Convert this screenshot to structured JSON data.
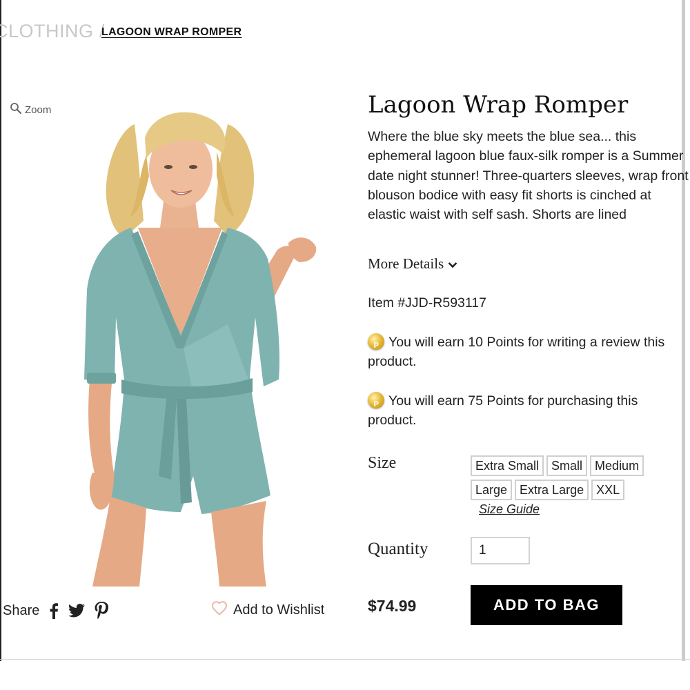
{
  "breadcrumb": {
    "parent": "CLOTHING",
    "separator": "/",
    "current": "LAGOON WRAP ROMPER"
  },
  "gallery": {
    "zoom_label": "Zoom",
    "image_alt": "Model wearing blue faux-silk wrap romper"
  },
  "share": {
    "label": "Share",
    "icons": [
      "facebook-icon",
      "twitter-icon",
      "pinterest-icon"
    ]
  },
  "wishlist": {
    "label": "Add to Wishlist",
    "icon": "heart-icon"
  },
  "product": {
    "title": "Lagoon Wrap Romper",
    "description": "Where the blue sky meets the blue sea... this ephemeral lagoon blue faux-silk romper is a Summer date night stunner! Three-quarters sleeves, wrap front blouson bodice with easy fit shorts is cinched at elastic waist with self sash. Shorts are lined",
    "more_details_label": "More Details",
    "item_number": "Item #JJD-R593117",
    "points": [
      "You will earn 10 Points for writing a review this product.",
      "You will earn 75 Points for purchasing this product."
    ],
    "size_label": "Size",
    "sizes": [
      "Extra Small",
      "Small",
      "Medium",
      "Large",
      "Extra Large",
      "XXL"
    ],
    "size_guide_label": "Size Guide",
    "quantity_label": "Quantity",
    "quantity_value": "1",
    "price": "$74.99",
    "add_to_bag_label": "ADD TO BAG"
  },
  "colors": {
    "romper": "#7fb3b0",
    "button": "#000000",
    "heart": "#e9b8a8",
    "coin": "#e0b43a"
  }
}
